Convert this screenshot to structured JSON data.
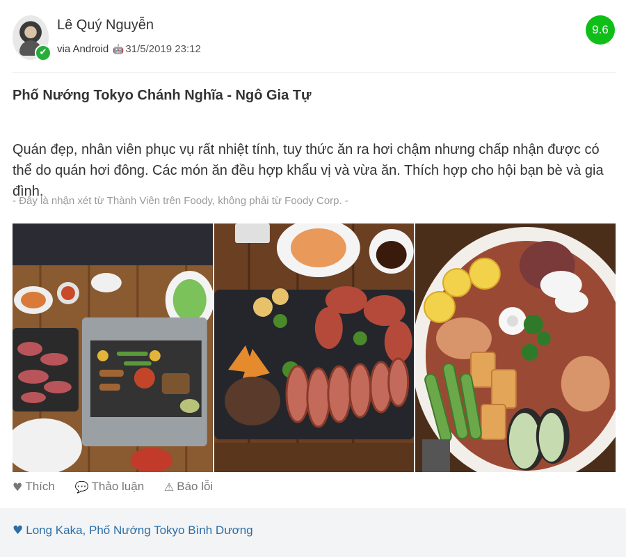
{
  "user": {
    "name": "Lê Quý Nguyễn",
    "via": "via Android",
    "timestamp": "31/5/2019 23:12",
    "icon": "android-icon",
    "verified_icon": "check-icon"
  },
  "score": "9.6",
  "colors": {
    "score_bg": "#0fbf18",
    "likes_link": "#2b6ea8"
  },
  "restaurant_title": "Phố Nướng Tokyo Chánh Nghĩa - Ngô Gia Tự",
  "review_text": "Quán đẹp, nhân viên phục vụ rất nhiệt tính, tuy thức ăn ra hơi chậm nhưng chấp nhận được có thể do quán hơi đông. Các món ăn đều hợp khẩu vị và vừa ăn. Thích hợp cho hội bạn bè và gia đình.",
  "disclaimer": "- Đây là nhận xét từ Thành Viên trên Foody, không phải từ Foody Corp. -",
  "actions": [
    {
      "label": "Thích",
      "icon": "heart-icon"
    },
    {
      "label": "Thảo luận",
      "icon": "comment-icon"
    },
    {
      "label": "Báo lỗi",
      "icon": "warning-icon"
    }
  ],
  "liked_by": "Long Kaka, Phố Nướng Tokyo Bình Dương"
}
